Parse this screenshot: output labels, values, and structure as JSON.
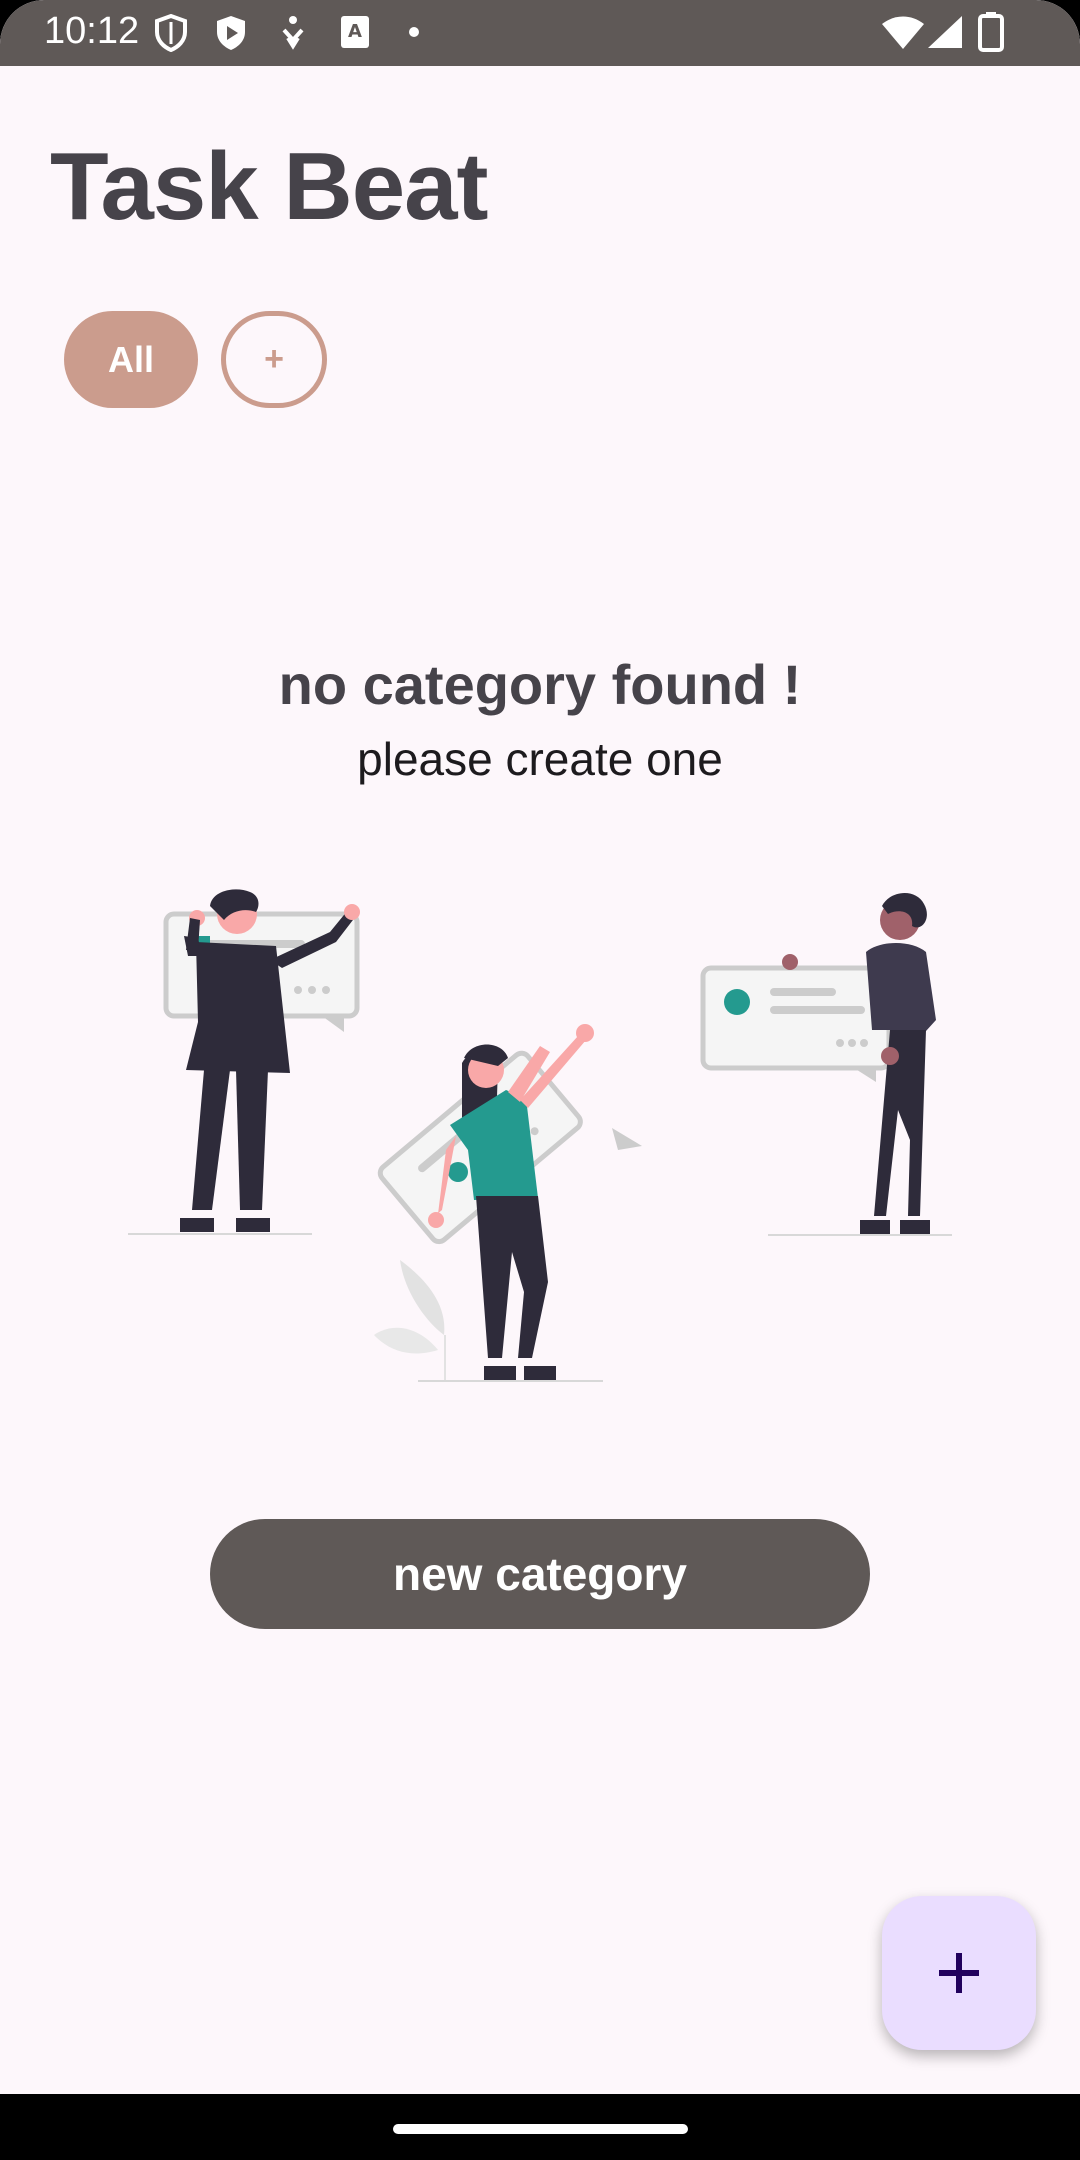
{
  "status_bar": {
    "time": "10:12",
    "icons_left": [
      "shield-icon",
      "play-protect-icon",
      "accessibility-icon",
      "font-icon",
      "dot-icon"
    ],
    "icons_right": [
      "wifi-icon",
      "signal-icon",
      "battery-icon"
    ]
  },
  "app": {
    "title": "Task Beat"
  },
  "chips": {
    "all_label": "All",
    "add_label": "+"
  },
  "empty_state": {
    "title": "no category found !",
    "subtitle": "please create one",
    "button_label": "new category"
  },
  "fab": {
    "label": "+",
    "icon": "plus-icon"
  },
  "colors": {
    "status_bar": "#5F5957",
    "background": "#FDF7FB",
    "chip": "#CB9C8D",
    "button": "#5F5957",
    "fab": "#EADDFF",
    "title": "#46434A",
    "accent_teal": "#249A8F"
  }
}
